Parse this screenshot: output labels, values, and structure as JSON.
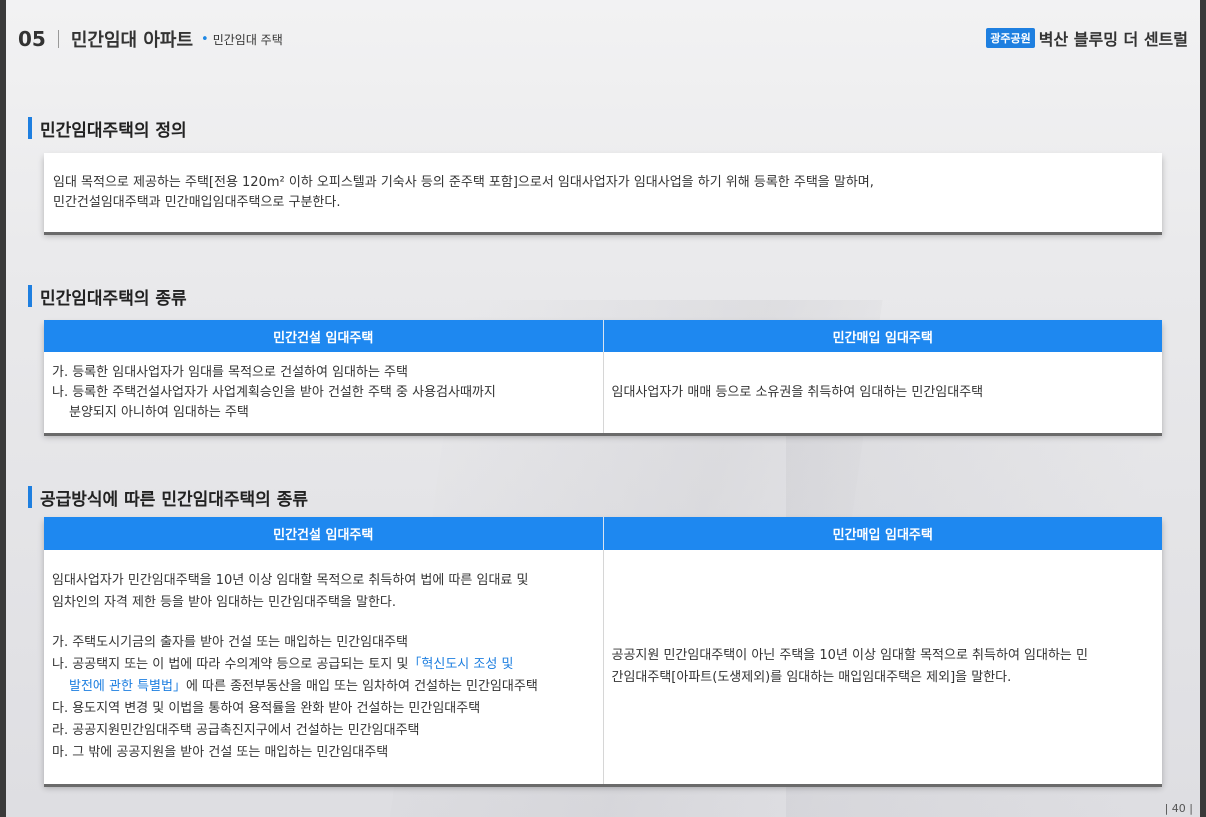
{
  "header": {
    "number": "05",
    "title": "민간임대 아파트",
    "subtitle": "민간임대 주택"
  },
  "brand": {
    "badge": "광주공원",
    "name": "벽산 블루밍 더 센트럴"
  },
  "colors": {
    "accent": "#1e88f0",
    "link": "#1e7fe0"
  },
  "section1": {
    "title": "민간임대주택의 정의",
    "lines": [
      "임대 목적으로 제공하는 주택[전용 120m² 이하 오피스텔과 기숙사 등의 준주택 포함]으로서 임대사업자가 임대사업을 하기 위해 등록한 주택을 말하며,",
      "민간건설임대주택과 민간매입임대주택으로 구분한다."
    ]
  },
  "section2": {
    "title": "민간임대주택의 종류",
    "headers": [
      "민간건설 임대주택",
      "민간매입 임대주택"
    ],
    "left_lines": [
      "가. 등록한 임대사업자가 임대를 목적으로 건설하여 임대하는 주택",
      "나. 등록한 주택건설사업자가 사업계획승인을 받아 건설한 주택 중 사용검사때까지",
      "분양되지 아니하여 임대하는 주택"
    ],
    "right_text": "임대사업자가 매매 등으로 소유권을 취득하여 임대하는 민간임대주택"
  },
  "section3": {
    "title": "공급방식에 따른 민간임대주택의 종류",
    "headers": [
      "민간건설 임대주택",
      "민간매입 임대주택"
    ],
    "intro_lines": [
      "임대사업자가 민간임대주택을 10년 이상 임대할 목적으로 취득하여 법에 따른 임대료 및",
      "임차인의 자격 제한 등을 받아 임대하는 민간임대주택을 말한다."
    ],
    "item_ga": "가. 주택도시기금의 출자를 받아 건설 또는 매입하는 민간임대주택",
    "item_na_pre": "나. 공공택지 또는 이 법에 따라 수의계약 등으로 공급되는 토지 및",
    "item_na_link1": "「혁신도시 조성 및",
    "item_na_link2": "발전에 관한 특별법」",
    "item_na_post": "에 따른 종전부동산을 매입 또는 임차하여 건설하는 민간임대주택",
    "item_da": "다. 용도지역 변경 및 이법을 통하여 용적률을 완화 받아 건설하는 민간임대주택",
    "item_ra": "라. 공공지원민간임대주택 공급촉진지구에서 건설하는 민간임대주택",
    "item_ma": "마. 그 밖에 공공지원을 받아 건설  또는 매입하는 민간임대주택",
    "right_lines": [
      "공공지원 민간임대주택이 아닌 주택을 10년 이상 임대할 목적으로 취득하여 임대하는 민",
      "간임대주택[아파트(도생제외)를 임대하는 매입임대주택은 제외]을 말한다."
    ]
  },
  "page_number": "| 40 |"
}
